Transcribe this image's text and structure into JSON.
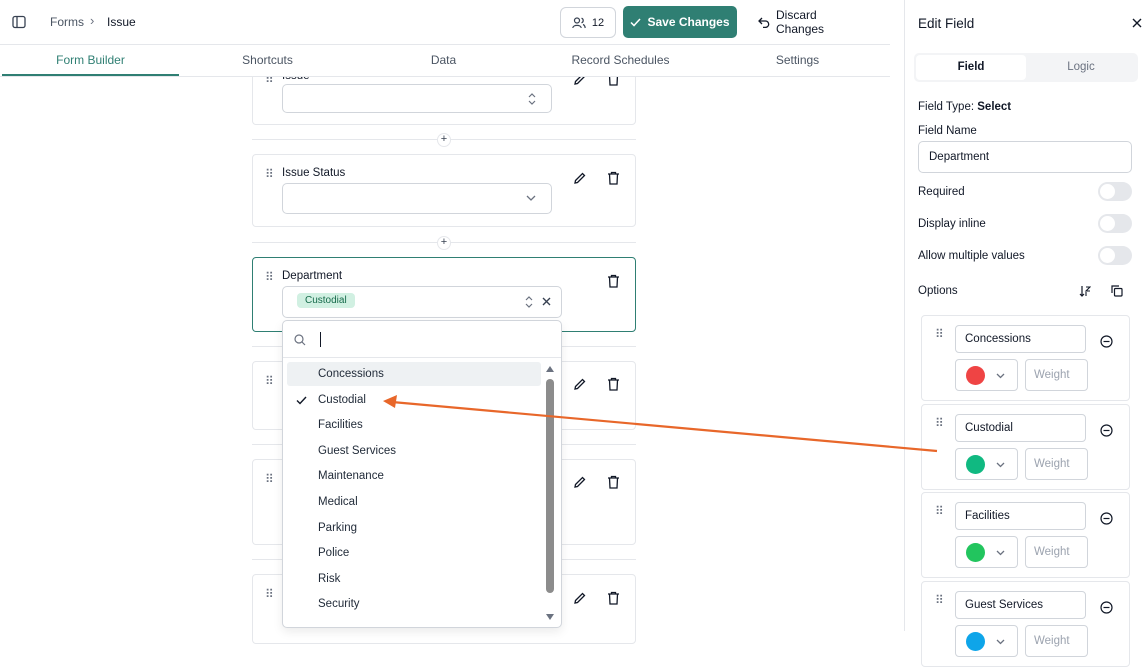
{
  "breadcrumb": {
    "forms": "Forms",
    "separator": "›",
    "issue": "Issue"
  },
  "toolbar": {
    "users_count": "12",
    "save_label": "Save Changes",
    "discard_label": "Discard Changes"
  },
  "tabs": [
    {
      "label": "Form Builder",
      "active": true
    },
    {
      "label": "Shortcuts"
    },
    {
      "label": "Data"
    },
    {
      "label": "Record Schedules"
    },
    {
      "label": "Settings"
    }
  ],
  "fields": [
    {
      "label": "Issue"
    },
    {
      "label": "Issue Status"
    },
    {
      "label": "Department",
      "selected_value": "Custodial"
    }
  ],
  "dropdown": {
    "search_placeholder": "",
    "options": [
      {
        "label": "Concessions",
        "highlighted": true
      },
      {
        "label": "Custodial",
        "checked": true
      },
      {
        "label": "Facilities"
      },
      {
        "label": "Guest Services"
      },
      {
        "label": "Maintenance"
      },
      {
        "label": "Medical"
      },
      {
        "label": "Parking"
      },
      {
        "label": "Police"
      },
      {
        "label": "Risk"
      },
      {
        "label": "Security"
      }
    ]
  },
  "panel": {
    "title": "Edit Field",
    "tab_field": "Field",
    "tab_logic": "Logic",
    "field_type_label": "Field Type:",
    "field_type_value": "Select",
    "field_name_label": "Field Name",
    "field_name_value": "Department",
    "required_label": "Required",
    "display_inline_label": "Display inline",
    "allow_multiple_label": "Allow multiple values",
    "options_label": "Options",
    "weight_placeholder": "Weight",
    "options": [
      {
        "name": "Concessions",
        "color": "#ef4444"
      },
      {
        "name": "Custodial",
        "color": "#10b981"
      },
      {
        "name": "Facilities",
        "color": "#22c55e"
      },
      {
        "name": "Guest Services",
        "color": "#0ea5e9"
      }
    ]
  },
  "colors": {
    "accent": "#2f7f73",
    "arrow": "#e8672a"
  }
}
